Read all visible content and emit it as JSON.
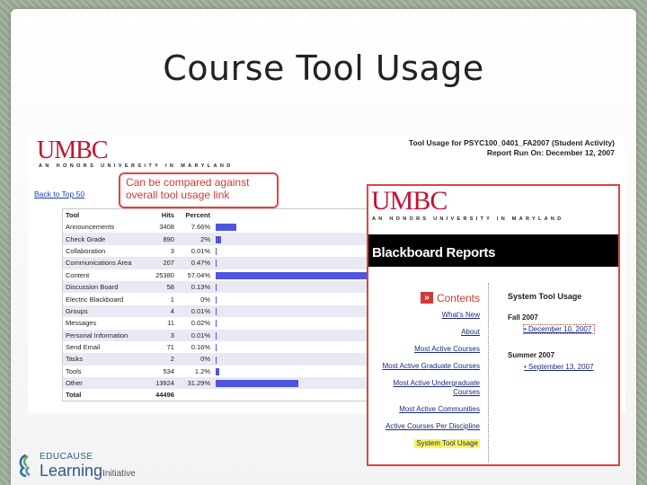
{
  "slide": {
    "title": "Course Tool Usage"
  },
  "report": {
    "logo": "UMBC",
    "tagline": "AN HONORS UNIVERSITY IN MARYLAND",
    "heading": "Tool Usage for PSYC100_0401_FA2007 (Student Activity)",
    "run_on": "Report Run On: December 12, 2007",
    "back_link": "Back to Top 50",
    "callout": "Can be compared against overall tool usage link",
    "columns": [
      "Tool",
      "Hits",
      "Percent"
    ],
    "rows": [
      {
        "tool": "Announcements",
        "hits": "3408",
        "percent": "7.66%",
        "pct": 7.66
      },
      {
        "tool": "Check Grade",
        "hits": "890",
        "percent": "2%",
        "pct": 2
      },
      {
        "tool": "Collaboration",
        "hits": "3",
        "percent": "0.01%",
        "pct": 0.01
      },
      {
        "tool": "Communications Area",
        "hits": "207",
        "percent": "0.47%",
        "pct": 0.47
      },
      {
        "tool": "Content",
        "hits": "25380",
        "percent": "57.04%",
        "pct": 57.04
      },
      {
        "tool": "Discussion Board",
        "hits": "58",
        "percent": "0.13%",
        "pct": 0.13
      },
      {
        "tool": "Electric Blackboard",
        "hits": "1",
        "percent": "0%",
        "pct": 0
      },
      {
        "tool": "Groups",
        "hits": "4",
        "percent": "0.01%",
        "pct": 0.01
      },
      {
        "tool": "Messages",
        "hits": "11",
        "percent": "0.02%",
        "pct": 0.02
      },
      {
        "tool": "Personal Information",
        "hits": "3",
        "percent": "0.01%",
        "pct": 0.01
      },
      {
        "tool": "Send Email",
        "hits": "71",
        "percent": "0.16%",
        "pct": 0.16
      },
      {
        "tool": "Tasks",
        "hits": "2",
        "percent": "0%",
        "pct": 0
      },
      {
        "tool": "Tools",
        "hits": "534",
        "percent": "1.2%",
        "pct": 1.2
      },
      {
        "tool": "Other",
        "hits": "13924",
        "percent": "31.29%",
        "pct": 31.29
      }
    ],
    "total_label": "Total",
    "total_hits": "44496",
    "bar_color": "#4f55e0"
  },
  "blackboard": {
    "logo": "UMBC",
    "tagline": "AN HONORS UNIVERSITY IN MARYLAND",
    "banner": "Blackboard Reports",
    "contents_label": "Contents",
    "nav": [
      "What's New",
      "About",
      "Most Active Courses",
      "Most Active Graduate Courses",
      "Most Active Undergraduate Courses",
      "Most Active Communities",
      "Active Courses Per Discipline"
    ],
    "nav_highlight": "System Tool Usage",
    "right_heading": "System Tool Usage",
    "semesters": [
      {
        "name": "Fall 2007",
        "report": "December 10, 2007"
      },
      {
        "name": "Summer 2007",
        "report": "September 13, 2007"
      }
    ]
  },
  "footer": {
    "brand_top": "EDUCAUSE",
    "brand_main": "Learning",
    "brand_suffix": "Initiative"
  }
}
